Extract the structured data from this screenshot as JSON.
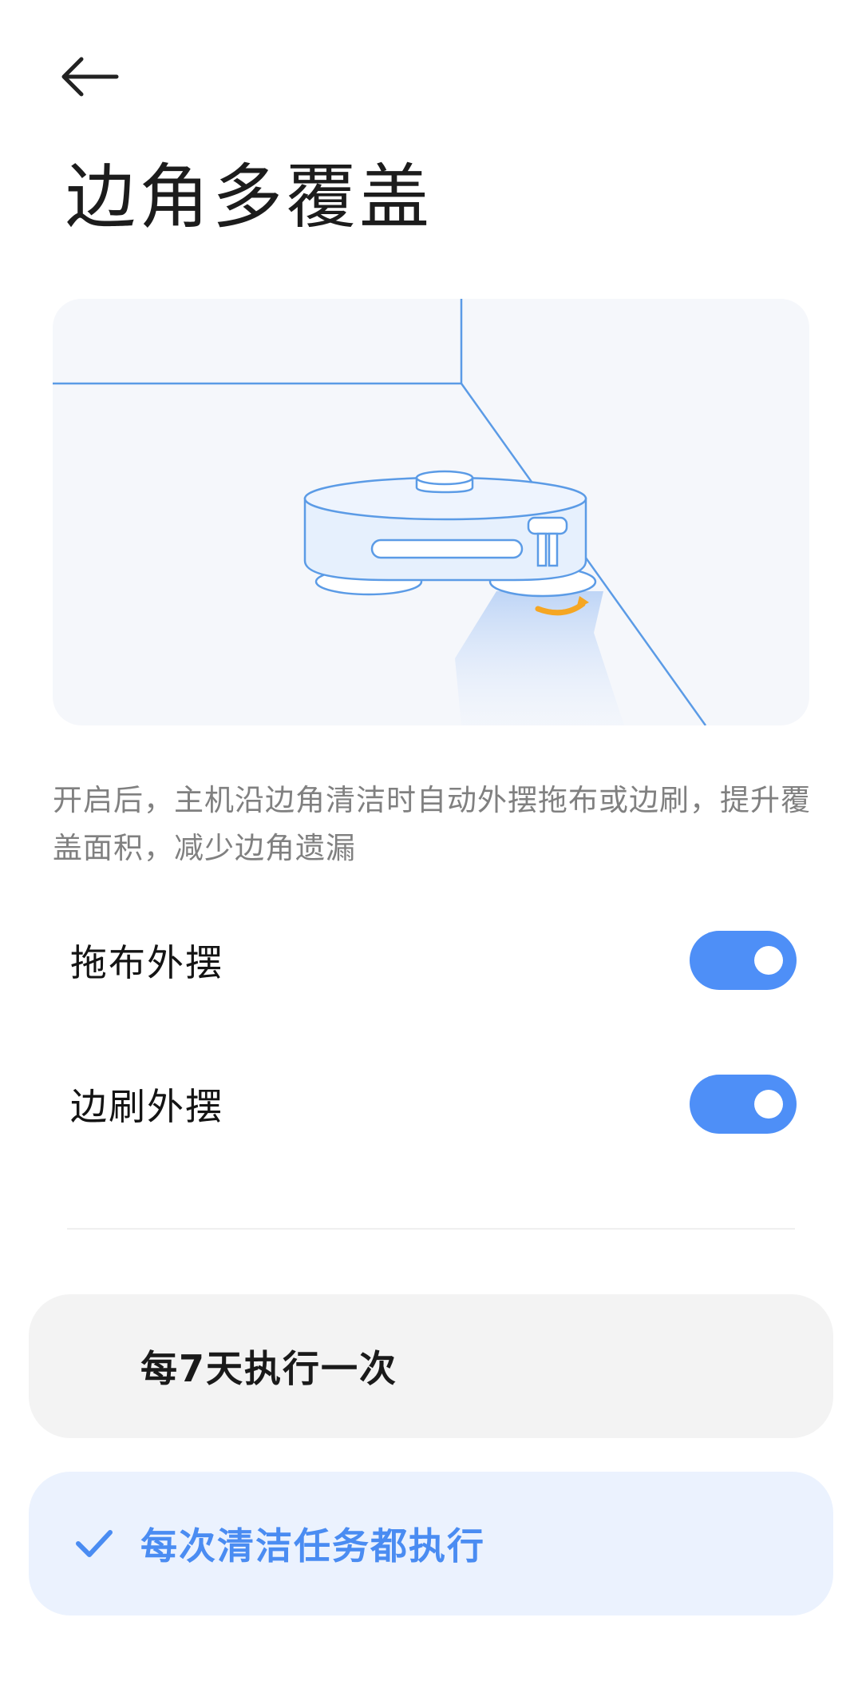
{
  "header": {
    "back_icon": "arrow-left-icon",
    "title": "边角多覆盖"
  },
  "description": "开启后，主机沿边角清洁时自动外摆拖布或边刷，提升覆盖面积，减少边角遗漏",
  "settings": [
    {
      "label": "拖布外摆",
      "enabled": true
    },
    {
      "label": "边刷外摆",
      "enabled": true
    }
  ],
  "frequency_options": [
    {
      "label": "每7天执行一次",
      "selected": false
    },
    {
      "label": "每次清洁任务都执行",
      "selected": true
    }
  ],
  "colors": {
    "accent": "#4e8ff7",
    "selected_text": "#4a8cf2",
    "selected_bg": "#ebf2fe",
    "illustration_line": "#5b9be6",
    "arrow_orange": "#f5a623"
  }
}
